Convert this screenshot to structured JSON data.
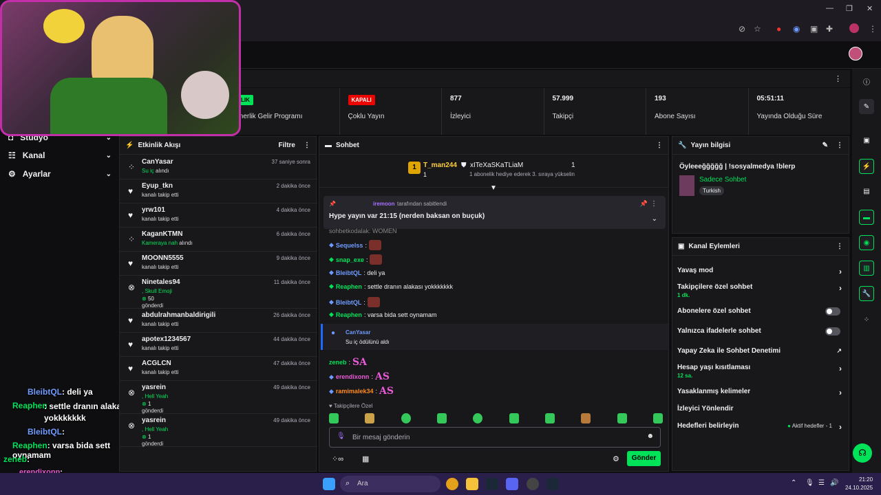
{
  "browser": {
    "window_controls": [
      "—",
      "❐",
      "✕"
    ]
  },
  "stats": [
    {
      "badge": "",
      "value": "",
      "label": "Ortaklık Gelir Programı",
      "partial_badge": "LIK"
    },
    {
      "badge": "KAPALI",
      "value": "",
      "label": "Çoklu Yayın"
    },
    {
      "badge": "",
      "value": "877",
      "label": "İzleyici"
    },
    {
      "badge": "",
      "value": "57.999",
      "label": "Takipçi"
    },
    {
      "badge": "",
      "value": "193",
      "label": "Abone Sayısı"
    },
    {
      "badge": "",
      "value": "05:51:11",
      "label": "Yayında Olduğu Süre"
    }
  ],
  "stat_label_truncated": "tnerlik Gelir Programı",
  "leftnav": {
    "items": [
      {
        "label": "Stüdyo"
      },
      {
        "label": "Kanal"
      },
      {
        "label": "Ayarlar"
      }
    ]
  },
  "overlay_chat": [
    {
      "user": "BleibtQL",
      "text": ": deli ya"
    },
    {
      "user": "Reaphen",
      "text": ": settle dranın alakası yokkkkkkk"
    },
    {
      "user": "BleibtQL",
      "text": ":"
    },
    {
      "user": "Reaphen",
      "text": ": varsa bida sett oynamam"
    },
    {
      "user": "zeneb",
      "text": ":"
    },
    {
      "user": "erendixonn",
      "text": ":"
    }
  ],
  "activity": {
    "title": "Etkinlik Akışı",
    "filter": "Filtre",
    "items": [
      {
        "name": "CanYasar",
        "time": "37 saniye sonra",
        "detail_green": "Su iç",
        "detail": " alındı",
        "icon": "channel-points-icon"
      },
      {
        "name": "Eyup_tkn",
        "time": "2 dakika önce",
        "detail_green": "",
        "detail": "kanalı takip etti",
        "icon": "heart-icon"
      },
      {
        "name": "yrw101",
        "time": "4 dakika önce",
        "detail_green": "",
        "detail": "kanalı takip etti",
        "icon": "heart-icon"
      },
      {
        "name": "KaganKTMN",
        "time": "6 dakika önce",
        "detail_green": "Kameraya nah",
        "detail": " alındı",
        "icon": "channel-points-icon"
      },
      {
        "name": "MOONN5555",
        "time": "9 dakika önce",
        "detail_green": "",
        "detail": "kanalı takip etti",
        "icon": "heart-icon"
      },
      {
        "name": "Ninetales94",
        "time": "11 dakika önce",
        "detail_green": ", Skull Emoji",
        "detail": "",
        "extra": "50",
        "extra2": "gönderdi",
        "icon": "bits-icon"
      },
      {
        "name": "abdulrahmanbaldirigili",
        "time": "26 dakika önce",
        "detail_green": "",
        "detail": "kanalı takip etti",
        "icon": "heart-icon"
      },
      {
        "name": "apotex1234567",
        "time": "44 dakika önce",
        "detail_green": "",
        "detail": "kanalı takip etti",
        "icon": "heart-icon"
      },
      {
        "name": "ACGLCN",
        "time": "47 dakika önce",
        "detail_green": "",
        "detail": "kanalı takip etti",
        "icon": "heart-icon"
      },
      {
        "name": "yasrein",
        "time": "49 dakika önce",
        "detail_green": ", Hell Yeah",
        "detail": "",
        "extra": "1",
        "extra2": "gönderdi",
        "icon": "bits-icon"
      },
      {
        "name": "yasrein",
        "time": "49 dakika önce",
        "detail_green": ", Hell Yeah",
        "detail": "",
        "extra": "1",
        "extra2": "gönderdi",
        "icon": "bits-icon"
      }
    ]
  },
  "chat": {
    "title": "Sohbet",
    "leaders": [
      {
        "rank": "1",
        "name": "T_man244",
        "count": "1"
      },
      {
        "name": "xITeXaSKaTLiaM",
        "count": "1",
        "note": "1 abonelik hediye ederek 3. sıraya yükselin"
      }
    ],
    "pinned": {
      "by": "iremoon",
      "by_suffix": " tarafından sabitlendi",
      "text": "Hype yayın var 21:15 (nerden baksan on buçuk)"
    },
    "cut_line": "sohbetkodalak: WOMEN",
    "messages": [
      {
        "user": "Sequelss",
        "text": ":",
        "color": "#6f9bff"
      },
      {
        "user": "snap_exe",
        "text": ":",
        "color": "#00e359"
      },
      {
        "user": "BleibtQL",
        "text": ": deli ya",
        "color": "#6f9bff"
      },
      {
        "user": "Reaphen",
        "text": ": settle dranın alakası yokkkkkkk",
        "color": "#00e359"
      },
      {
        "user": "BleibtQL",
        "text": ":",
        "color": "#6f9bff"
      },
      {
        "user": "Reaphen",
        "text": ": varsa bida sett oynamam",
        "color": "#00e359"
      }
    ],
    "redeem": {
      "user": "CanYasar",
      "text": "Su iç ödülünü aldı"
    },
    "messages2": [
      {
        "user": "zeneb",
        "text": ":",
        "color": "#00e359"
      },
      {
        "user": "erendixonn",
        "text": ":",
        "color": "#e85ad7"
      },
      {
        "user": "ramimalek34",
        "text": ":",
        "color": "#ff8a1c"
      }
    ],
    "mode": "Takipçilere Özel",
    "placeholder": "Bir mesaj gönderin",
    "send": "Gönder"
  },
  "info": {
    "title": "Yayın bilgisi",
    "stream_title": "Öyleeeğğğğğ | !sosyalmedya !blerp",
    "category": "Sadece Sohbet",
    "tag": "Turkish"
  },
  "actions": {
    "title": "Kanal Eylemleri",
    "items": [
      {
        "label": "Yavaş mod",
        "sub": "",
        "kind": "arrow"
      },
      {
        "label": "Takipçilere özel sohbet",
        "sub": "1 dk.",
        "kind": "arrow"
      },
      {
        "label": "Abonelere özel sohbet",
        "sub": "",
        "kind": "toggle"
      },
      {
        "label": "Yalnızca ifadelerle sohbet",
        "sub": "",
        "kind": "toggle"
      },
      {
        "label": "Yapay Zeka ile Sohbet Denetimi",
        "sub": "",
        "kind": "external"
      },
      {
        "label": "Hesap yaşı kısıtlaması",
        "sub": "12 sa.",
        "kind": "arrow"
      },
      {
        "label": "Yasaklanmış kelimeler",
        "sub": "",
        "kind": "arrow"
      },
      {
        "label": "İzleyici Yönlendir",
        "sub": "",
        "kind": "none"
      },
      {
        "label": "Hedefleri belirleyin",
        "sub": "",
        "kind": "arrow",
        "right": "Aktif hedefler - 1"
      }
    ]
  },
  "taskbar": {
    "search": "Ara",
    "time": "21:20",
    "date": "24.10.2025"
  },
  "colors": {
    "accent_green": "#00e359",
    "live_red": "#eb0400",
    "purple_border": "#c22fa8",
    "taskbar": "#2a1f4a"
  }
}
